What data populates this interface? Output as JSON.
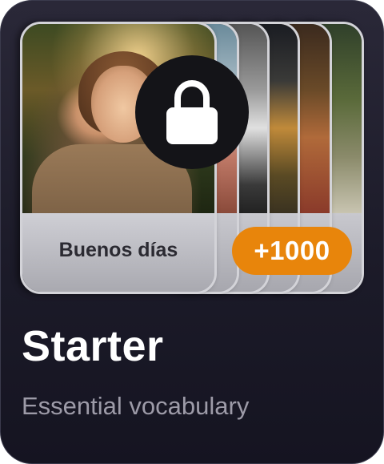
{
  "pack": {
    "title": "Starter",
    "subtitle": "Essential vocabulary",
    "locked": true,
    "lock_icon": "lock-icon",
    "extra_count_label": "+1000",
    "front_card": {
      "caption": "Buenos días",
      "image": "photo of smiling woman waving in sunlit garden"
    },
    "colors": {
      "card_background": "#1c1b29",
      "badge": "#e8850b",
      "lock_circle": "#141418",
      "title_text": "#ffffff",
      "subtitle_text": "#9d9ba8"
    }
  }
}
